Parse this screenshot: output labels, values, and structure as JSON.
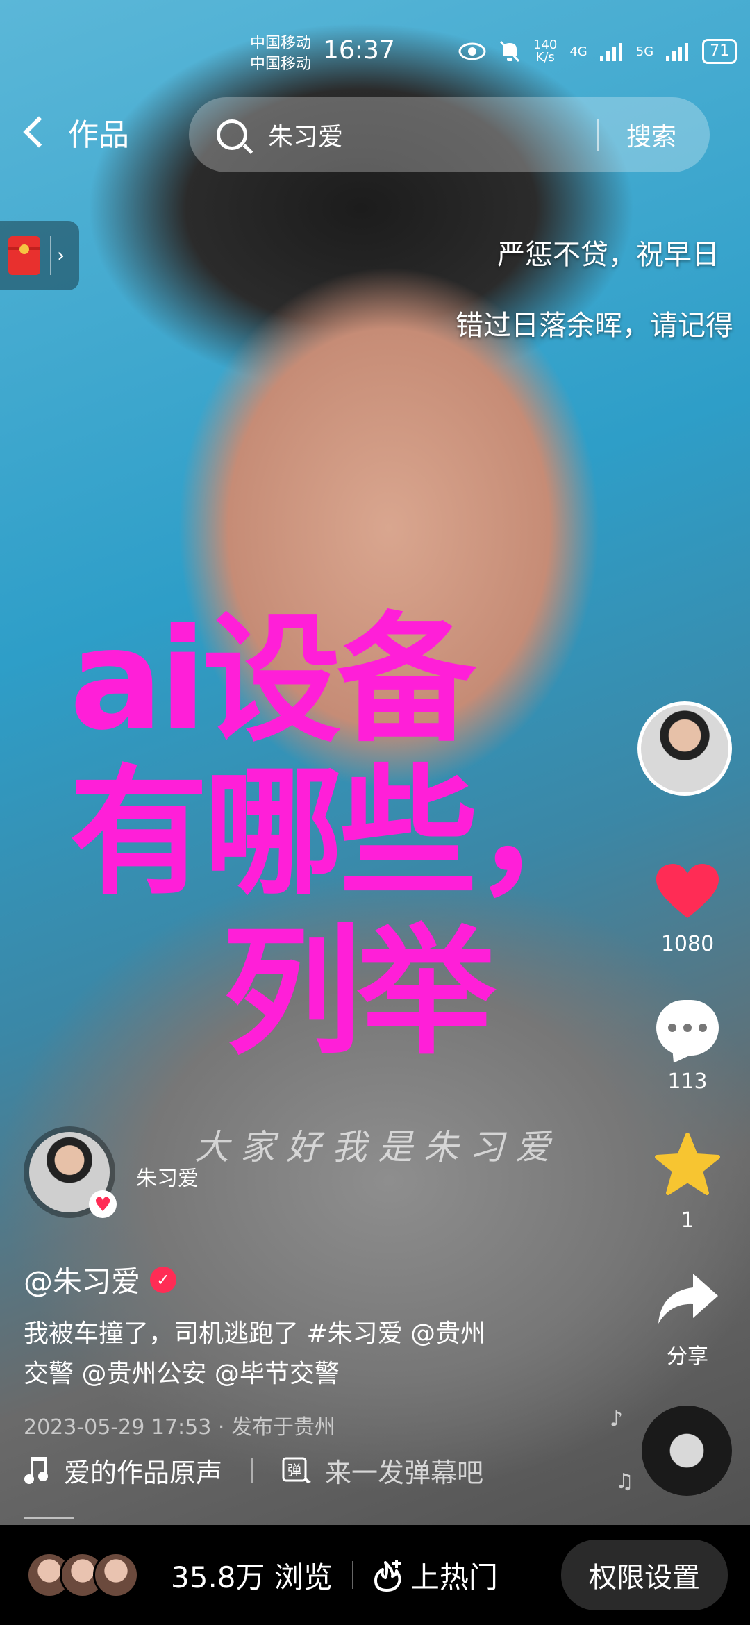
{
  "status_bar": {
    "carrier_1": "中国移动",
    "carrier_2": "中国移动",
    "time": "16:37",
    "net_speed_value": "140",
    "net_speed_unit": "K/s",
    "signal_1": "4G",
    "signal_2": "5G",
    "battery": "71"
  },
  "header": {
    "back_label": "作品",
    "search_query": "朱习爱",
    "search_button": "搜索"
  },
  "lyrics": {
    "line1": "严惩不贷，祝早日",
    "line2": "错过日落余晖，请记得"
  },
  "overlay_title": {
    "line1": "ai设备",
    "line2": "有哪些，",
    "line3": "列举"
  },
  "video_watermark": "大家好我是朱习爱",
  "right_rail": {
    "likes": "1080",
    "comments": "113",
    "favorites": "1",
    "share_label": "分享"
  },
  "author": {
    "name": "朱习爱",
    "handle": "@朱习爱"
  },
  "description": {
    "line1": "我被车撞了，司机逃跑了 #朱习爱 @贵州",
    "line2": "交警 @贵州公安 @毕节交警"
  },
  "meta": "2023-05-29 17:53 · 发布于贵州",
  "music_label": "爱的作品原声",
  "danmu_prompt": "来一发弹幕吧",
  "bottom_bar": {
    "views": "35.8万 浏览",
    "hot": "上热门",
    "permissions": "权限设置"
  },
  "colors": {
    "title_magenta": "#ff1fd8",
    "like_red": "#ff2c55",
    "star_yellow": "#f7c531"
  }
}
